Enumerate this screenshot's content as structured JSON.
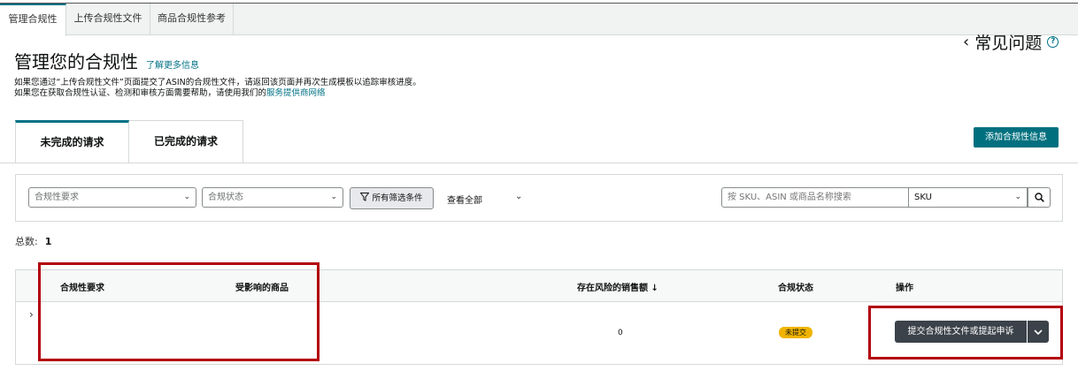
{
  "top_tabs": [
    "管理合规性",
    "上传合规性文件",
    "商品合规性参考"
  ],
  "header": {
    "title": "管理您的合规性",
    "learn_more": "了解更多信息",
    "desc_line1": "如果您通过“上传合规性文件”页面提交了ASIN的合规性文件，请返回该页面并再次生成模板以追踪审核进度。",
    "desc_line2_prefix": "如果您在获取合规性认证、检测和审核方面需要帮助，请使用我们的",
    "desc_line2_link": "服务提供商网络",
    "faq": "常见问题"
  },
  "status_tabs": [
    "未完成的请求",
    "已完成的请求"
  ],
  "add_button": "添加合规性信息",
  "filters": {
    "requirement_placeholder": "合规性要求",
    "status_placeholder": "合规状态",
    "all_filters": "所有筛选条件",
    "view_all": "查看全部",
    "search_placeholder": "按 SKU、ASIN 或商品名称搜索",
    "search_type": "SKU"
  },
  "total": {
    "label": "总数:",
    "count": "1"
  },
  "table": {
    "headers": {
      "requirement": "合规性要求",
      "affected": "受影响的商品",
      "sales": "存在风险的销售额 ↓",
      "status": "合规状态",
      "action": "操作"
    },
    "rows": [
      {
        "sales": "0",
        "status": "未提交",
        "action": "提交合规性文件或提起申诉"
      }
    ]
  },
  "colors": {
    "accent": "#007185",
    "button_dark": "#3b4249",
    "badge": "#f0b400",
    "highlight": "#b3000c"
  }
}
